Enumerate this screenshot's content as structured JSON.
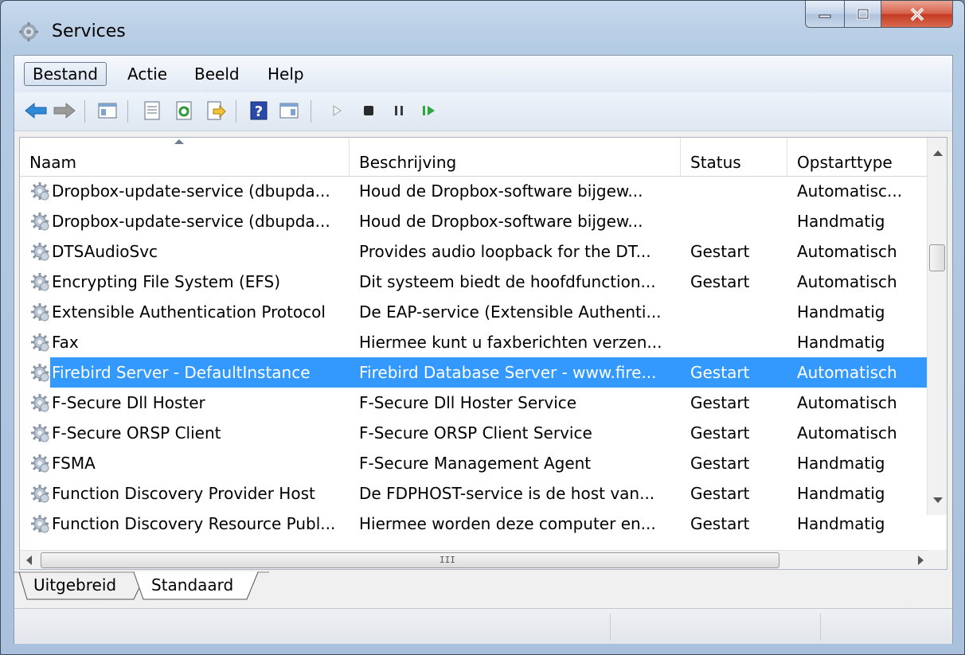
{
  "window": {
    "title": "Services"
  },
  "menu": {
    "items": [
      {
        "label": "Bestand",
        "active": true
      },
      {
        "label": "Actie",
        "active": false
      },
      {
        "label": "Beeld",
        "active": false
      },
      {
        "label": "Help",
        "active": false
      }
    ]
  },
  "toolbar": {
    "buttons": [
      "back-icon",
      "forward-icon",
      "show-hide-console-tree-icon",
      "properties-icon",
      "refresh-icon",
      "export-list-icon",
      "help-icon",
      "show-hide-action-pane-icon",
      "start-service-icon",
      "stop-service-icon",
      "pause-service-icon",
      "restart-service-icon"
    ]
  },
  "columns": {
    "name": "Naam",
    "description": "Beschrijving",
    "status": "Status",
    "startup": "Opstarttype"
  },
  "services": [
    {
      "name": "Dropbox-update-service (dbupda...",
      "description": "Houd de Dropbox-software bijgew...",
      "status": "",
      "startup": "Automatisc..."
    },
    {
      "name": "Dropbox-update-service (dbupda...",
      "description": "Houd de Dropbox-software bijgew...",
      "status": "",
      "startup": "Handmatig"
    },
    {
      "name": "DTSAudioSvc",
      "description": "Provides audio loopback for the DT...",
      "status": "Gestart",
      "startup": "Automatisch"
    },
    {
      "name": "Encrypting File System (EFS)",
      "description": "Dit systeem biedt de hoofdfunction...",
      "status": "Gestart",
      "startup": "Automatisch"
    },
    {
      "name": "Extensible Authentication Protocol",
      "description": "De EAP-service (Extensible Authenti...",
      "status": "",
      "startup": "Handmatig"
    },
    {
      "name": "Fax",
      "description": "Hiermee kunt u faxberichten verzen...",
      "status": "",
      "startup": "Handmatig"
    },
    {
      "name": "Firebird Server - DefaultInstance",
      "description": "Firebird Database Server - www.fire...",
      "status": "Gestart",
      "startup": "Automatisch",
      "selected": true
    },
    {
      "name": "F-Secure Dll Hoster",
      "description": "F-Secure Dll Hoster Service",
      "status": "Gestart",
      "startup": "Automatisch"
    },
    {
      "name": "F-Secure ORSP Client",
      "description": "F-Secure ORSP Client Service",
      "status": "Gestart",
      "startup": "Automatisch"
    },
    {
      "name": "FSMA",
      "description": "F-Secure Management Agent",
      "status": "Gestart",
      "startup": "Handmatig"
    },
    {
      "name": "Function Discovery Provider Host",
      "description": "De FDPHOST-service is de host van...",
      "status": "Gestart",
      "startup": "Handmatig"
    },
    {
      "name": "Function Discovery Resource Publ...",
      "description": "Hiermee worden deze computer en...",
      "status": "Gestart",
      "startup": "Handmatig"
    }
  ],
  "scrollbar": {
    "grip": "III"
  },
  "tabs": [
    {
      "label": "Uitgebreid",
      "active": false
    },
    {
      "label": "Standaard",
      "active": true
    }
  ],
  "colors": {
    "selection": "#3399ff",
    "window_frame": "#b4cbe4"
  }
}
